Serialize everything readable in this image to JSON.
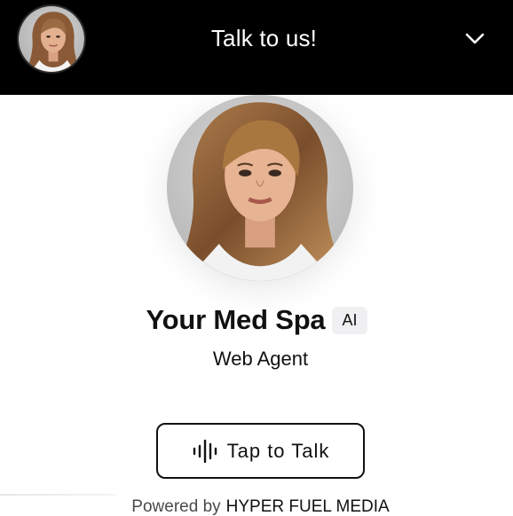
{
  "header": {
    "title": "Talk to us!",
    "avatar_icon": "portrait-avatar",
    "collapse_icon": "chevron-down-icon"
  },
  "agent": {
    "name": "Your Med Spa",
    "badge": "AI",
    "role": "Web Agent"
  },
  "actions": {
    "talk_label": "Tap to Talk",
    "talk_icon": "audio-waveform-icon"
  },
  "footer": {
    "powered_prefix": "Powered by",
    "brand": "HYPER FUEL MEDIA"
  },
  "colors": {
    "header_bg": "#000000",
    "text": "#111111",
    "badge_bg": "#f0f0f2"
  }
}
